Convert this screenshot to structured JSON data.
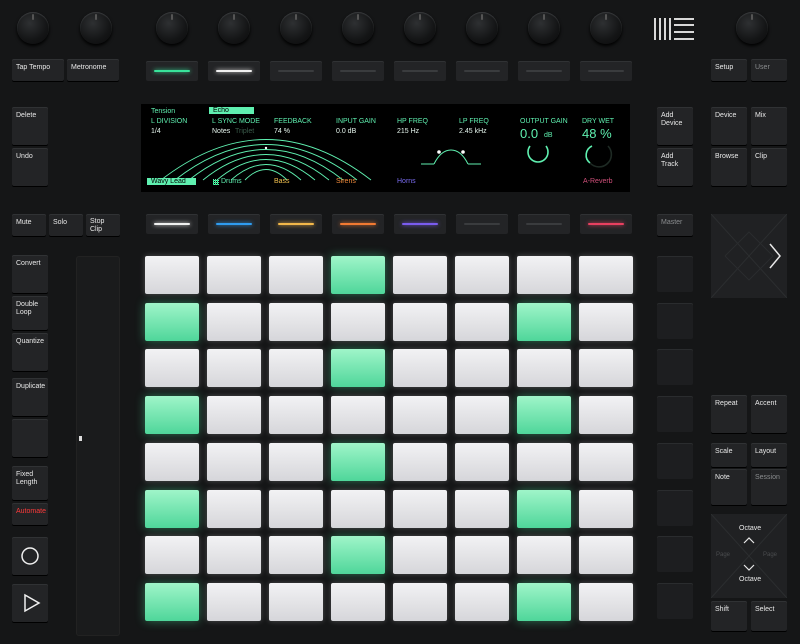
{
  "top_buttons": {
    "tap_tempo": "Tap Tempo",
    "metronome": "Metronome",
    "setup": "Setup",
    "user": "User"
  },
  "left_buttons": {
    "delete": "Delete",
    "undo": "Undo",
    "mute": "Mute",
    "solo": "Solo",
    "stop_clip": "Stop Clip",
    "convert": "Convert",
    "double_loop": "Double Loop",
    "quantize": "Quantize",
    "duplicate": "Duplicate",
    "fixed_length": "Fixed Length",
    "automate": "Automate"
  },
  "right_buttons": {
    "add_device": "Add Device",
    "add_track": "Add Track",
    "device": "Device",
    "mix": "Mix",
    "browse": "Browse",
    "clip": "Clip",
    "master": "Master",
    "repeat": "Repeat",
    "accent": "Accent",
    "scale": "Scale",
    "layout": "Layout",
    "note": "Note",
    "session": "Session",
    "octave_up": "Octave",
    "octave_down": "Octave",
    "page_left": "Page",
    "page_right": "Page",
    "shift": "Shift",
    "select": "Select"
  },
  "screen": {
    "tab_tension": "Tension",
    "tab_echo": "Echo",
    "params": [
      {
        "label": "L DIVISION",
        "value": "1/4"
      },
      {
        "label": "L SYNC MODE",
        "value": "Notes",
        "value2": "Triplet"
      },
      {
        "label": "FEEDBACK",
        "value": "74 %"
      },
      {
        "label": "INPUT GAIN",
        "value": "0.0 dB"
      },
      {
        "label": "HP FREQ",
        "value": "215 Hz"
      },
      {
        "label": "LP FREQ",
        "value": "2.45 kHz"
      },
      {
        "label": "OUTPUT GAIN",
        "value": "0.0",
        "unit": "dB"
      },
      {
        "label": "DRY WET",
        "value": "48 %"
      }
    ],
    "tracks": [
      "Wavy Lead",
      "Drums",
      "Bass",
      "Sirens",
      "Horns",
      "A-Reverb"
    ],
    "drums_icon": "grid-icon",
    "colors": {
      "accent": "#5ff0b0",
      "bass": "#f2c14e",
      "sirens": "#f28c3c",
      "horns": "#7a6cf0",
      "reverb": "#d0507a"
    }
  },
  "upper_strip_leds": [
    "#39e39b",
    "#f0f0f0",
    "#3a3c3e",
    "#3a3c3e",
    "#3a3c3e",
    "#3a3c3e",
    "#3a3c3e",
    "#3a3c3e"
  ],
  "lower_strip_leds": [
    "#f0f0f0",
    "#2f9cf0",
    "#f2b84a",
    "#f27a32",
    "#7a5cf0",
    "#3a3c3e",
    "#3a3c3e",
    "#e84060"
  ],
  "pad_grid": [
    [
      0,
      0,
      0,
      1,
      0,
      0,
      0,
      0
    ],
    [
      1,
      0,
      0,
      0,
      0,
      0,
      1,
      0
    ],
    [
      0,
      0,
      0,
      1,
      0,
      0,
      0,
      0
    ],
    [
      1,
      0,
      0,
      0,
      0,
      0,
      1,
      0
    ],
    [
      0,
      0,
      0,
      1,
      0,
      0,
      0,
      0
    ],
    [
      1,
      0,
      0,
      0,
      0,
      0,
      1,
      0
    ],
    [
      0,
      0,
      0,
      1,
      0,
      0,
      0,
      0
    ],
    [
      1,
      0,
      0,
      0,
      0,
      0,
      1,
      0
    ]
  ]
}
